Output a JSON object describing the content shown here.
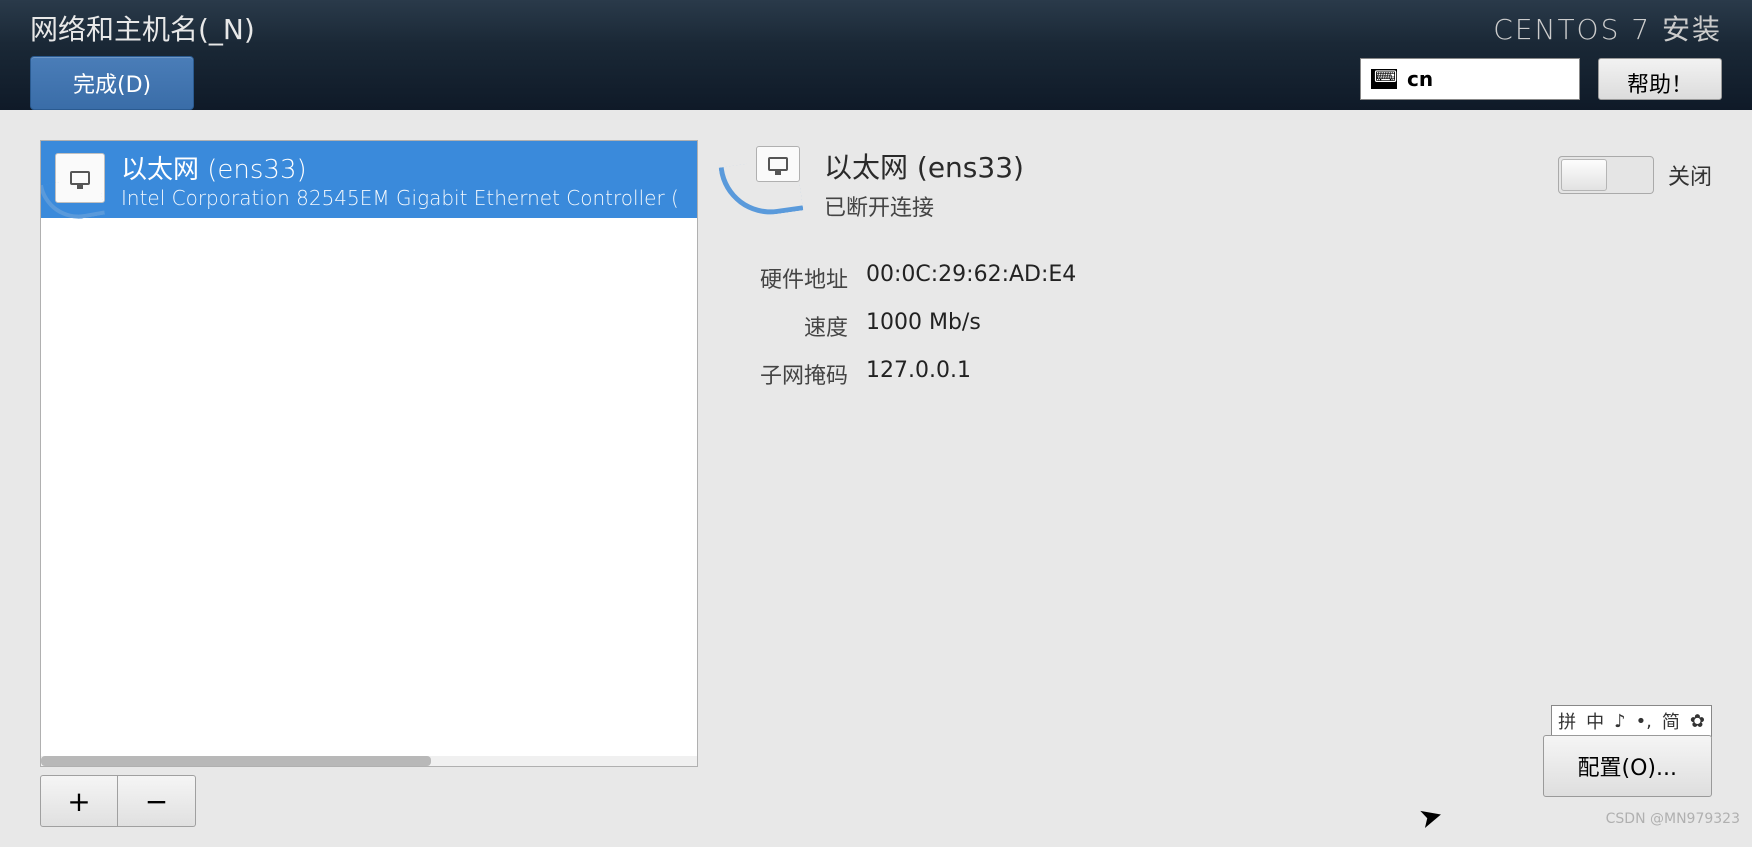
{
  "header": {
    "page_title": "网络和主机名(_N)",
    "done_label": "完成(D)",
    "installer_title": "CENTOS 7 安装",
    "lang_code": "cn",
    "help_label": "帮助！"
  },
  "sidebar": {
    "devices": [
      {
        "name": "以太网 (ens33)",
        "desc": "Intel Corporation 82545EM Gigabit Ethernet Controller ("
      }
    ],
    "add_label": "+",
    "remove_label": "−"
  },
  "details": {
    "title": "以太网 (ens33)",
    "status": "已断开连接",
    "toggle_label": "关闭",
    "info": {
      "hw_addr_label": "硬件地址",
      "hw_addr_value": "00:0C:29:62:AD:E4",
      "speed_label": "速度",
      "speed_value": "1000 Mb/s",
      "subnet_label": "子网掩码",
      "subnet_value": "127.0.0.1"
    },
    "configure_label": "配置(O)..."
  },
  "ime": {
    "i1": "拼",
    "i2": "中",
    "i3": "♪",
    "i4": "•,",
    "i5": "简",
    "i6": "✿"
  },
  "watermark": "CSDN @MN979323"
}
